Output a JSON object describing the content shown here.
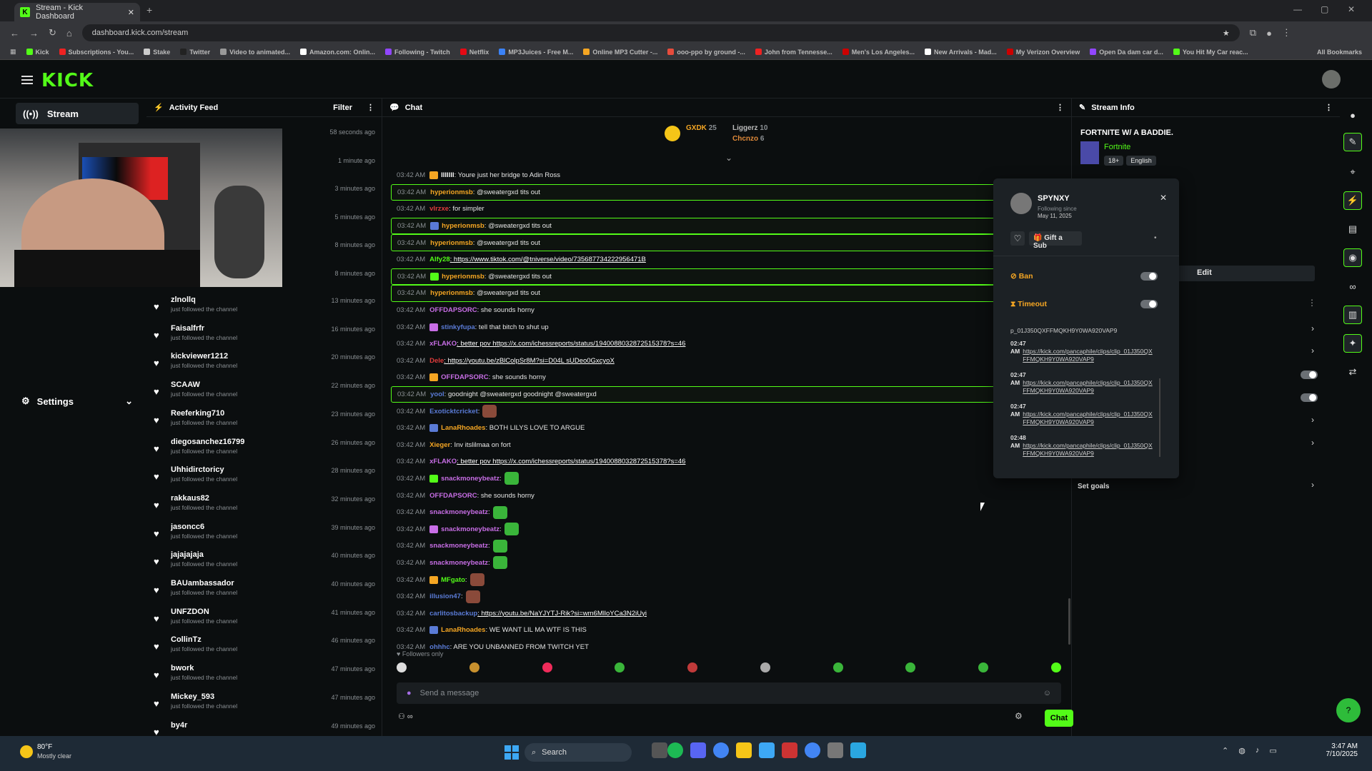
{
  "browser": {
    "tab_title": "Stream - Kick Dashboard",
    "url": "dashboard.kick.com/stream",
    "bookmarks": [
      "Kick",
      "Subscriptions - You...",
      "Stake",
      "Twitter",
      "Video to animated...",
      "Amazon.com: Onlin...",
      "Following - Twitch",
      "Netflix",
      "MP3Juices - Free M...",
      "Online MP3 Cutter -...",
      "ooo-ppo by ground -...",
      "John from Tennesse...",
      "Men's Los Angeles...",
      "New Arrivals - Mad...",
      "My Verizon Overview",
      "Open Da dam car d...",
      "You Hit My Car reac..."
    ],
    "all_bookmarks": "All Bookmarks"
  },
  "kick": {
    "logo": "KICK"
  },
  "nav": {
    "stream": "Stream",
    "settings": "Settings"
  },
  "activity": {
    "title": "Activity Feed",
    "filter": "Filter",
    "times": [
      "58 seconds ago",
      "1 minute ago",
      "3 minutes ago",
      "5 minutes ago",
      "8 minutes ago",
      "8 minutes ago"
    ],
    "follows": [
      {
        "name": "zlnollq",
        "sub": "just followed the channel",
        "time": "13 minutes ago"
      },
      {
        "name": "Faisalfrfr",
        "sub": "just followed the channel",
        "time": "16 minutes ago"
      },
      {
        "name": "kickviewer1212",
        "sub": "just followed the channel",
        "time": "20 minutes ago"
      },
      {
        "name": "SCAAW",
        "sub": "just followed the channel",
        "time": "22 minutes ago"
      },
      {
        "name": "Reeferking710",
        "sub": "just followed the channel",
        "time": "23 minutes ago"
      },
      {
        "name": "diegosanchez16799",
        "sub": "just followed the channel",
        "time": "26 minutes ago"
      },
      {
        "name": "Uhhidirctoricy",
        "sub": "just followed the channel",
        "time": "28 minutes ago"
      },
      {
        "name": "rakkaus82",
        "sub": "just followed the channel",
        "time": "32 minutes ago"
      },
      {
        "name": "jasoncc6",
        "sub": "just followed the channel",
        "time": "39 minutes ago"
      },
      {
        "name": "jajajajaja",
        "sub": "just followed the channel",
        "time": "40 minutes ago"
      },
      {
        "name": "BAUambassador",
        "sub": "just followed the channel",
        "time": "40 minutes ago"
      },
      {
        "name": "UNFZDON",
        "sub": "just followed the channel",
        "time": "41 minutes ago"
      },
      {
        "name": "CollinTz",
        "sub": "just followed the channel",
        "time": "46 minutes ago"
      },
      {
        "name": "bwork",
        "sub": "just followed the channel",
        "time": "47 minutes ago"
      },
      {
        "name": "Mickey_593",
        "sub": "just followed the channel",
        "time": "47 minutes ago"
      },
      {
        "name": "by4r",
        "sub": "",
        "time": "49 minutes ago"
      }
    ]
  },
  "chat": {
    "title": "Chat",
    "pinned": {
      "a": "GXDK",
      "a_count": "25",
      "b": "Liggerz",
      "b_count": "10",
      "c": "Chcnzo",
      "c_count": "6"
    },
    "messages": [
      {
        "ts": "03:42 AM",
        "user": "lllllll",
        "color": "#ffffff",
        "text": ": Youre just her bridge to Adin Ross",
        "hl": false,
        "link": false
      },
      {
        "ts": "03:42 AM",
        "user": "hyperionmsb",
        "color": "#f5a623",
        "text": ": @sweatergxd tits out",
        "hl": true,
        "link": false
      },
      {
        "ts": "03:42 AM",
        "user": "vlrzxe",
        "color": "#e03c3c",
        "text": ": for simpler",
        "hl": false,
        "link": false
      },
      {
        "ts": "03:42 AM",
        "user": "hyperionmsb",
        "color": "#f5a623",
        "text": ": @sweatergxd tits out",
        "hl": true,
        "link": false
      },
      {
        "ts": "03:42 AM",
        "user": "hyperionmsb",
        "color": "#f5a623",
        "text": ": @sweatergxd tits out",
        "hl": true,
        "link": false
      },
      {
        "ts": "03:42 AM",
        "user": "Alfy28",
        "color": "#53fc18",
        "text": ": https://www.tiktok.com/@tniverse/video/735687734222956471B",
        "hl": false,
        "link": true
      },
      {
        "ts": "03:42 AM",
        "user": "hyperionmsb",
        "color": "#f5a623",
        "text": ": @sweatergxd tits out",
        "hl": true,
        "link": false
      },
      {
        "ts": "03:42 AM",
        "user": "hyperionmsb",
        "color": "#f5a623",
        "text": ": @sweatergxd tits out",
        "hl": true,
        "link": false
      },
      {
        "ts": "03:42 AM",
        "user": "OFFDAPSORC",
        "color": "#c86ee6",
        "text": ": she sounds horny",
        "hl": false,
        "link": false
      },
      {
        "ts": "03:42 AM",
        "user": "stinkyfupa",
        "color": "#5a7bd6",
        "text": ": tell that bitch to shut up",
        "hl": false,
        "link": false
      },
      {
        "ts": "03:42 AM",
        "user": "xFLAKO",
        "color": "#c86ee6",
        "text": ": better pov https://x.com/ichessreports/status/1940088032872515378?s=46",
        "hl": false,
        "link": true
      },
      {
        "ts": "03:42 AM",
        "user": "Dele",
        "color": "#e03c3c",
        "text": ": https://youtu.be/zBlColpSr8M?si=D04L sUDeo0GxcyoX",
        "hl": false,
        "link": true
      },
      {
        "ts": "03:42 AM",
        "user": "OFFDAPSORC",
        "color": "#c86ee6",
        "text": ": she sounds horny",
        "hl": false,
        "link": false
      },
      {
        "ts": "03:42 AM",
        "user": "yool",
        "color": "#5a7bd6",
        "text": ": goodnight @sweatergxd goodnight @sweatergxd",
        "hl": true,
        "link": false
      },
      {
        "ts": "03:42 AM",
        "user": "Exoticktcricket",
        "color": "#5a7bd6",
        "text": ":",
        "hl": false,
        "link": false,
        "emote": "#8a4a3a"
      },
      {
        "ts": "03:42 AM",
        "user": "LanaRhoades",
        "color": "#f5a623",
        "text": ": BOTH LILYS LOVE TO ARGUE",
        "hl": false,
        "link": false
      },
      {
        "ts": "03:42 AM",
        "user": "Xieger",
        "color": "#f5a623",
        "text": ": Inv itslilmaa on fort",
        "hl": false,
        "link": false
      },
      {
        "ts": "03:42 AM",
        "user": "xFLAKO",
        "color": "#c86ee6",
        "text": ": better pov https://x.com/ichessreports/status/1940088032872515378?s=46",
        "hl": false,
        "link": true
      },
      {
        "ts": "03:42 AM",
        "user": "snackmoneybeatz",
        "color": "#c86ee6",
        "text": ":",
        "hl": false,
        "link": false,
        "emote": "#3ab53a"
      },
      {
        "ts": "03:42 AM",
        "user": "OFFDAPSORC",
        "color": "#c86ee6",
        "text": ": she sounds horny",
        "hl": false,
        "link": false
      },
      {
        "ts": "03:42 AM",
        "user": "snackmoneybeatz",
        "color": "#c86ee6",
        "text": ":",
        "hl": false,
        "link": false,
        "emote": "#3ab53a"
      },
      {
        "ts": "03:42 AM",
        "user": "snackmoneybeatz",
        "color": "#c86ee6",
        "text": ":",
        "hl": false,
        "link": false,
        "emote": "#3ab53a"
      },
      {
        "ts": "03:42 AM",
        "user": "snackmoneybeatz",
        "color": "#c86ee6",
        "text": ":",
        "hl": false,
        "link": false,
        "emote": "#3ab53a"
      },
      {
        "ts": "03:42 AM",
        "user": "snackmoneybeatz",
        "color": "#c86ee6",
        "text": ":",
        "hl": false,
        "link": false,
        "emote": "#3ab53a"
      },
      {
        "ts": "03:42 AM",
        "user": "MFgato",
        "color": "#53fc18",
        "text": ":",
        "hl": false,
        "link": false,
        "emote": "#8a4a3a"
      },
      {
        "ts": "03:42 AM",
        "user": "illusion47",
        "color": "#5a7bd6",
        "text": ":",
        "hl": false,
        "link": false,
        "emote": "#8a4a3a"
      },
      {
        "ts": "03:42 AM",
        "user": "carlitosbackup",
        "color": "#5a7bd6",
        "text": ": https://youtu.be/NaYJYTJ-Rik?si=wm6MlloYCa3N2iUyi",
        "hl": false,
        "link": true
      },
      {
        "ts": "03:42 AM",
        "user": "LanaRhoades",
        "color": "#f5a623",
        "text": ": WE WANT LIL MA WTF IS THIS",
        "hl": false,
        "link": false
      },
      {
        "ts": "03:42 AM",
        "user": "ohhhc",
        "color": "#5a7bd6",
        "text": ": ARE YOU UNBANNED FROM TWITCH YET",
        "hl": false,
        "link": false
      }
    ],
    "followers_only": "Followers only",
    "placeholder": "Send a message",
    "chat_button": "Chat"
  },
  "stream_info": {
    "title": "Stream Info",
    "stream_title": "FORTNITE W/ A BADDIE.",
    "category": "Fortnite",
    "tags": [
      "18+",
      "English"
    ],
    "edit": "Edit",
    "set_goals": "Set goals"
  },
  "popup": {
    "username": "SPYNXY",
    "following_since_label": "Following since",
    "following_since": "May 11, 2025",
    "gift": "Gift a Sub",
    "ban": "Ban",
    "timeout": "Timeout",
    "first_line": "p_01J350QXFFMQKH9Y0WA920VAP9",
    "items": [
      {
        "time": "02:47",
        "ampm": "AM",
        "link": "https://kick.com/pancaphile/clips/clip_01J350QXFFMQKH9Y0WA920VAP9"
      },
      {
        "time": "02:47",
        "ampm": "AM",
        "link": "https://kick.com/pancaphile/clips/clip_01J350QXFFMQKH9Y0WA920VAP9"
      },
      {
        "time": "02:47",
        "ampm": "AM",
        "link": "https://kick.com/pancaphile/clips/clip_01J350QXFFMQKH9Y0WA920VAP9"
      },
      {
        "time": "02:48",
        "ampm": "AM",
        "link": "https://kick.com/pancaphile/clips/clip_01J350QXFFMQKH9Y0WA920VAP9"
      }
    ]
  },
  "taskbar": {
    "weather_temp": "80°F",
    "weather_desc": "Mostly clear",
    "search": "Search",
    "time": "3:47 AM",
    "date": "7/10/2025"
  }
}
